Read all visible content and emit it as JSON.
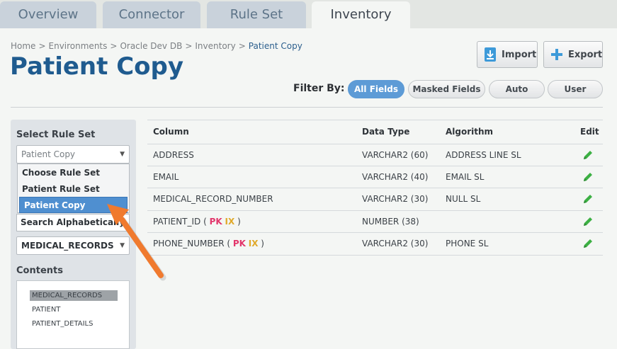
{
  "tabs": [
    {
      "label": "Overview"
    },
    {
      "label": "Connector"
    },
    {
      "label": "Rule Set"
    },
    {
      "label": "Inventory"
    }
  ],
  "breadcrumb": {
    "items": [
      "Home",
      "Environments",
      "Oracle Dev DB",
      "Inventory"
    ],
    "current": "Patient Copy",
    "separator": ">"
  },
  "page_title": "Patient Copy",
  "toolbar": {
    "import_label": "Import",
    "export_label": "Export"
  },
  "filter": {
    "label": "Filter By:",
    "options": [
      "All Fields",
      "Masked Fields",
      "Auto",
      "User"
    ],
    "active": "All Fields"
  },
  "sidebar": {
    "rule_set_heading": "Select Rule Set",
    "rule_set_value": "Patient Copy",
    "dropdown_options": [
      "Choose Rule Set",
      "Patient Rule Set",
      "Patient Copy"
    ],
    "dropdown_selected": "Patient Copy",
    "search_label": "Search Alphabetically",
    "table_select_value": "MEDICAL_RECORDS",
    "contents_heading": "Contents",
    "contents_items": [
      "MEDICAL_RECORDS",
      "PATIENT",
      "PATIENT_DETAILS"
    ]
  },
  "table": {
    "headers": {
      "column": "Column",
      "data_type": "Data Type",
      "algorithm": "Algorithm",
      "edit": "Edit"
    },
    "rows": [
      {
        "column": "ADDRESS",
        "pk": "",
        "ix": "",
        "data_type": "VARCHAR2 (60)",
        "algorithm": "ADDRESS LINE SL"
      },
      {
        "column": "EMAIL",
        "pk": "",
        "ix": "",
        "data_type": "VARCHAR2 (40)",
        "algorithm": "EMAIL SL"
      },
      {
        "column": "MEDICAL_RECORD_NUMBER",
        "pk": "",
        "ix": "",
        "data_type": "VARCHAR2 (30)",
        "algorithm": "NULL SL"
      },
      {
        "column": "PATIENT_ID",
        "pk": "PK",
        "ix": "IX",
        "data_type": "NUMBER (38)",
        "algorithm": ""
      },
      {
        "column": "PHONE_NUMBER",
        "pk": "PK",
        "ix": "IX",
        "data_type": "VARCHAR2 (30)",
        "algorithm": "PHONE SL"
      }
    ]
  },
  "colors": {
    "title_blue": "#1f5b8f",
    "active_pill": "#5d9bd6",
    "pk": "#e2366b",
    "ix": "#e0a92a",
    "edit_icon": "#3cb043",
    "annotation_arrow": "#f07a2e"
  },
  "icons": {
    "import": "download-icon",
    "export": "plus-icon",
    "edit": "pencil-icon",
    "caret": "chevron-down-icon"
  }
}
